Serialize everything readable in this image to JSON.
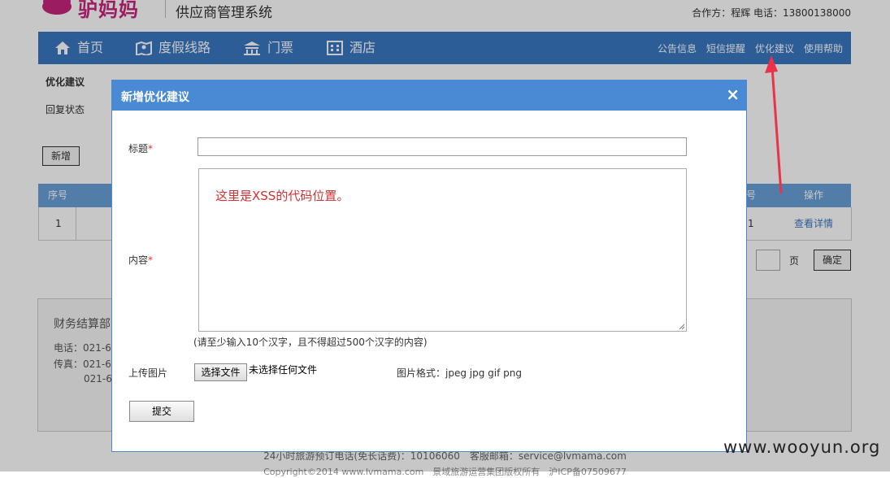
{
  "header": {
    "logo_text": "驴妈妈",
    "system_title": "供应商管理系统",
    "partner_info": "合作方：程辉 电话：13800138000"
  },
  "nav": {
    "items": [
      {
        "label": "首页",
        "icon": "home-icon"
      },
      {
        "label": "度假线路",
        "icon": "map-icon"
      },
      {
        "label": "门票",
        "icon": "temple-icon"
      },
      {
        "label": "酒店",
        "icon": "building-icon"
      }
    ],
    "right_links": [
      "公告信息",
      "短信提醒",
      "优化建议",
      "使用帮助"
    ]
  },
  "page": {
    "side_title": "优化建议",
    "reply_status": "回复状态",
    "add_button": "新增",
    "table": {
      "headers": [
        "序号",
        "号",
        "操作"
      ],
      "rows": [
        {
          "index": "1",
          "num": "1",
          "action": "查看详情"
        }
      ]
    },
    "pager": {
      "page_label": "页",
      "confirm": "确定"
    },
    "footer": {
      "dept": "财务结算部",
      "phone": "电话：021-6",
      "fax": "传真：021-6",
      "fax2": "021-6"
    },
    "bottom_line1": "24小时旅游预订电话(免长话费)：10106060　客服邮箱：service@lvmama.com",
    "bottom_line2": "Copyright©2014 www.lvmama.com　景域旅游运营集团版权所有　沪ICP备07509677"
  },
  "dialog": {
    "title": "新增优化建议",
    "close": "×",
    "title_label": "标题",
    "content_label": "内容",
    "required_mark": "*",
    "content_value": "这里是XSS的代码位置。",
    "hint": "(请至少输入10个汉字，且不得超过500个汉字的内容)",
    "upload_label": "上传图片",
    "file_button": "选择文件",
    "file_none": "未选择任何文件",
    "image_format": "图片格式：jpeg jpg gif png",
    "submit": "提交"
  },
  "watermark": "www.wooyun.org",
  "colors": {
    "nav": "#3a78c2",
    "dialog_head": "#4a8ad4",
    "logo": "#c8257e",
    "arrow": "#e8334a"
  }
}
